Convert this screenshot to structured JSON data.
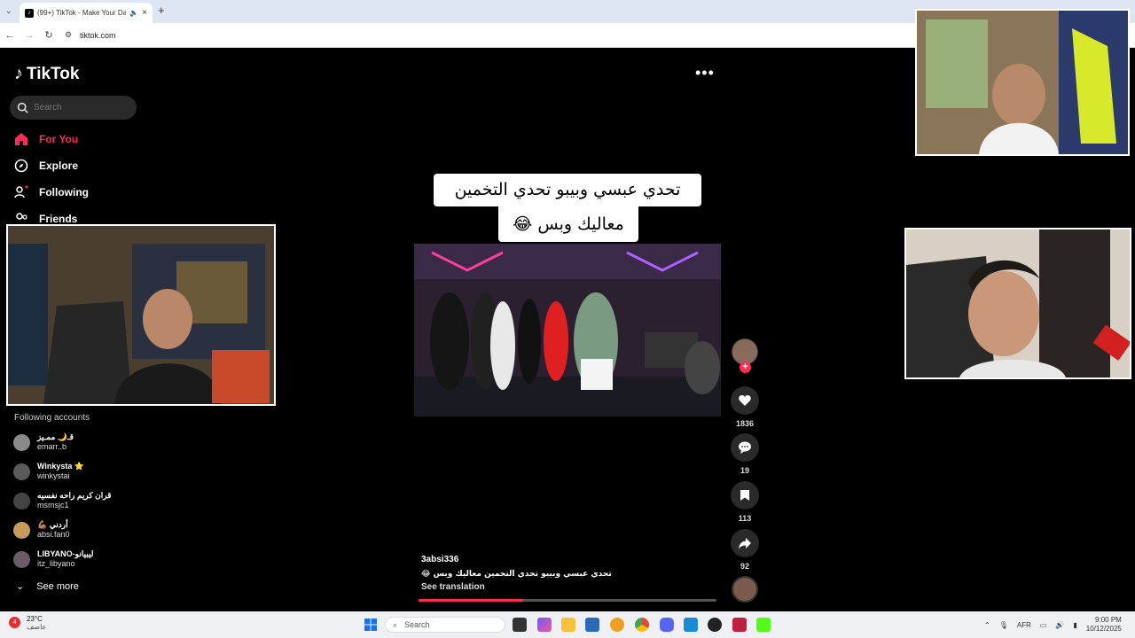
{
  "browser": {
    "tab_title": "(99+) TikTok - Make Your Da",
    "url": "tiktok.com"
  },
  "sidebar": {
    "logo": "TikTok",
    "search_placeholder": "Search",
    "nav": [
      {
        "label": "For You",
        "icon": "home-icon",
        "active": true
      },
      {
        "label": "Explore",
        "icon": "compass-icon"
      },
      {
        "label": "Following",
        "icon": "following-icon"
      },
      {
        "label": "Friends",
        "icon": "friends-icon"
      }
    ],
    "following_title": "Following accounts",
    "accounts": [
      {
        "name": "قـ🌙 ممـيز",
        "username": "emarr..b"
      },
      {
        "name": "Winkysta ⭐",
        "username": "winkystai"
      },
      {
        "name": "قران كريم راحه نفسيه",
        "username": "msmsjc1"
      },
      {
        "name": "💪🏽 أردني",
        "username": "absi.fan0"
      },
      {
        "name": "LIBYANO-ليبيانو",
        "username": "itz_libyano"
      }
    ],
    "see_more": "See more"
  },
  "video": {
    "caption_line1": "تحدي عبسي وبيبو تحدي التخمين",
    "caption_line2": "معاليك وبس 😂",
    "author": "3absi336",
    "description": "تحدي عبسي وبيبو تحدي التخمين معاليك وبس 😂",
    "see_translation": "See translation",
    "progress": 0.35,
    "more_label": "•••"
  },
  "actions": {
    "likes": "1836",
    "comments": "19",
    "saves": "113",
    "shares": "92"
  },
  "colors": {
    "accent": "#fe2c55",
    "bg": "#000000"
  },
  "taskbar": {
    "temperature": "23°C",
    "weather_text": "عاصف",
    "search": "Search",
    "lang": "AFR",
    "time": "9:00 PM",
    "date": "10/12/2025",
    "notification_badge": "4"
  }
}
